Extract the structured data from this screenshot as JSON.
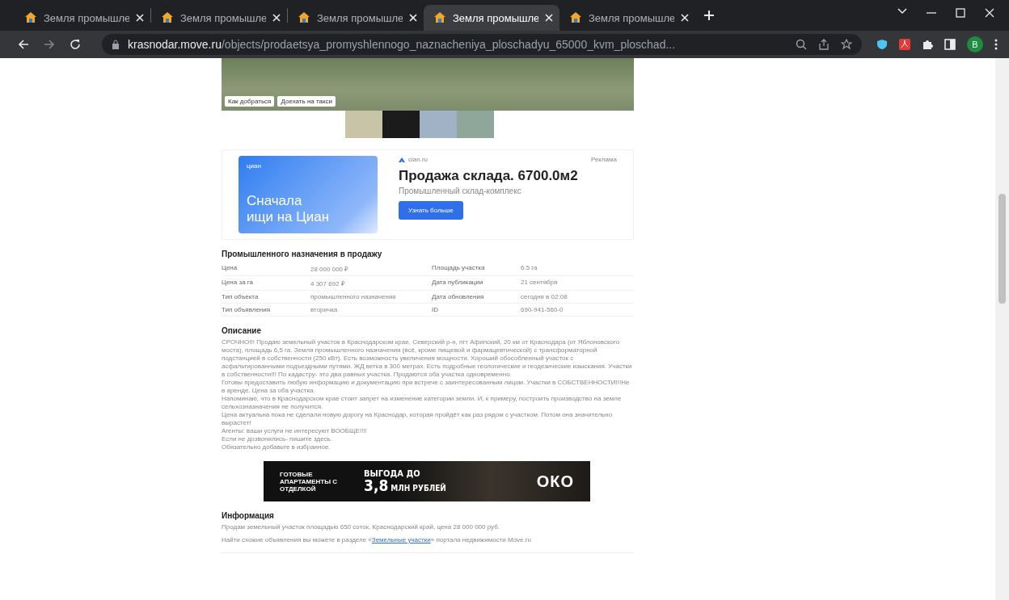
{
  "tabs": [
    {
      "title": "Земля промышле",
      "selected": false
    },
    {
      "title": "Земля промышле",
      "selected": false
    },
    {
      "title": "Земля промышле",
      "selected": false
    },
    {
      "title": "Земля промышле",
      "selected": true
    },
    {
      "title": "Земля промышле",
      "selected": false
    }
  ],
  "address_bar": {
    "host": "krasnodar.move.ru",
    "path": "/objects/prodaetsya_promyshlennogo_naznacheniya_ploschadyu_65000_kvm_ploschad..."
  },
  "profile": {
    "initial": "B"
  },
  "map": {
    "buttons": [
      "Как добраться",
      "Доехать на такси"
    ]
  },
  "ad": {
    "banner_logo": "циан",
    "banner_text": "Сначала ищи на Циан",
    "source": "cian.ru",
    "label": "Реклама",
    "title": "Продажа склада. 6700.0м2",
    "subtitle": "Промышленный склад-комплекс",
    "button": "Узнать больше"
  },
  "specs": {
    "title": "Промышленного назначения в продажу",
    "rows": [
      [
        "Цена",
        "28 000 000 ₽",
        "Площадь участка",
        "6.5 га"
      ],
      [
        "Цена за га",
        "4 307 692 ₽",
        "Дата публикации",
        "21 сентября"
      ],
      [
        "Тип объекта",
        "промышленного назначения",
        "Дата обновления",
        "сегодня в 02:08"
      ],
      [
        "Тип объявления",
        "вторичка",
        "ID",
        "690-941-560-0"
      ]
    ]
  },
  "description": {
    "title": "Описание",
    "paragraphs": [
      "СРОЧНО!!! Продаю земельный участок в Краснодарском крае, Северский р-н, пгт Афипский, 20 км от Краснодара (от Яблоновского моста), площадь 6,5 га. Земля промышленного назначения (всё, кроме пищевой и фармацевтической) с трансформаторной подстанцией в собственности (250 кВт). Есть возможность увеличения мощности. Хороший обособленный участок с асфальтированными подъездными путями. ЖД ветка в 300 метрах. Есть подробные геологические и геодезические изыскания. Участки в собственности!!! По кадастру- это два равных участка. Продаются оба участка одновременно.",
      "Готовы предоставить любую информацию и документацию при встрече с заинтересованным лицом. Участки в СОБСТВЕННОСТИ!!!Не в аренде. Цена за оба участка.",
      "Напоминаю, что в Краснодарском крае стоит запрет на изменение категории земли. И, к примеру, построить производство на земле сельхозназначения не получится.",
      "Цена актуальна пока не сделали новую дорогу на Краснодар, которая пройдёт как раз рядом с участком. Потом она значительно вырастет!",
      "Агенты: ваши услуги не интересуют ВООБЩЕ!!!!",
      "Если не дозвонились- пишите здесь.",
      "Обязательно добавьте в избранное."
    ]
  },
  "banner": {
    "left": "ГОТОВЫЕ АПАРТАМЕНТЫ С ОТДЕЛКОЙ",
    "offer_top": "ВЫГОДА ДО",
    "offer_big": "3,8",
    "offer_unit": "МЛН РУБЛЕЙ",
    "logo": "ОКО"
  },
  "info": {
    "title": "Информация",
    "text": "Продам земельный участок площадью 650 соток, Краснодарский край, цена 28 000 000 руб.",
    "link_before": "Найти схожие объявления вы можете в разделе «",
    "link": "Земельные участки",
    "link_after": "» портала недвижимости Move.ru"
  }
}
